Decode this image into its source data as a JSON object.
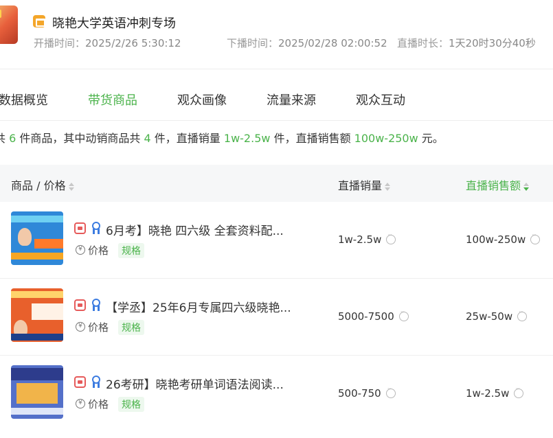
{
  "header": {
    "title": "晓艳大学英语冲刺专场",
    "start_label": "开播时间：",
    "start_value": "2025/2/26 5:30:12",
    "end_label": "下播时间：",
    "end_value": "2025/02/28 02:00:52",
    "duration_label": "直播时长：",
    "duration_value": "1天20时30分40秒"
  },
  "tabs": [
    {
      "label": "数据概览"
    },
    {
      "label": "带货商品"
    },
    {
      "label": "观众画像"
    },
    {
      "label": "流量来源"
    },
    {
      "label": "观众互动"
    }
  ],
  "summary": {
    "p1": "共",
    "total": "6",
    "p2": "件商品，其中动销商品共",
    "active": "4",
    "p3": "件，直播销量",
    "sales": "1w-2.5w",
    "p4": "件，直播销售额",
    "revenue": "100w-250w",
    "p5": "元。"
  },
  "table": {
    "col_product": "商品 / 价格",
    "col_sales": "直播销量",
    "col_revenue": "直播销售额",
    "price_label": "价格",
    "spec_label": "规格",
    "rows": [
      {
        "name": "6月考】晓艳 四六级 全套资料配...",
        "sales": "1w-2.5w",
        "revenue": "100w-250w"
      },
      {
        "name": "【学丞】25年6月专属四六级晓艳...",
        "sales": "5000-7500",
        "revenue": "25w-50w"
      },
      {
        "name": "26考研】晓艳考研单词语法阅读...",
        "sales": "500-750",
        "revenue": "1w-2.5w"
      }
    ]
  },
  "colors": {
    "accent": "#4bb34b",
    "header_bg": "#f6f7f8"
  },
  "icons": [
    "shop-bag-icon",
    "store-badge-icon",
    "award-ribbon-icon",
    "price-coin-icon",
    "more-dots-icon",
    "sort-icon"
  ]
}
